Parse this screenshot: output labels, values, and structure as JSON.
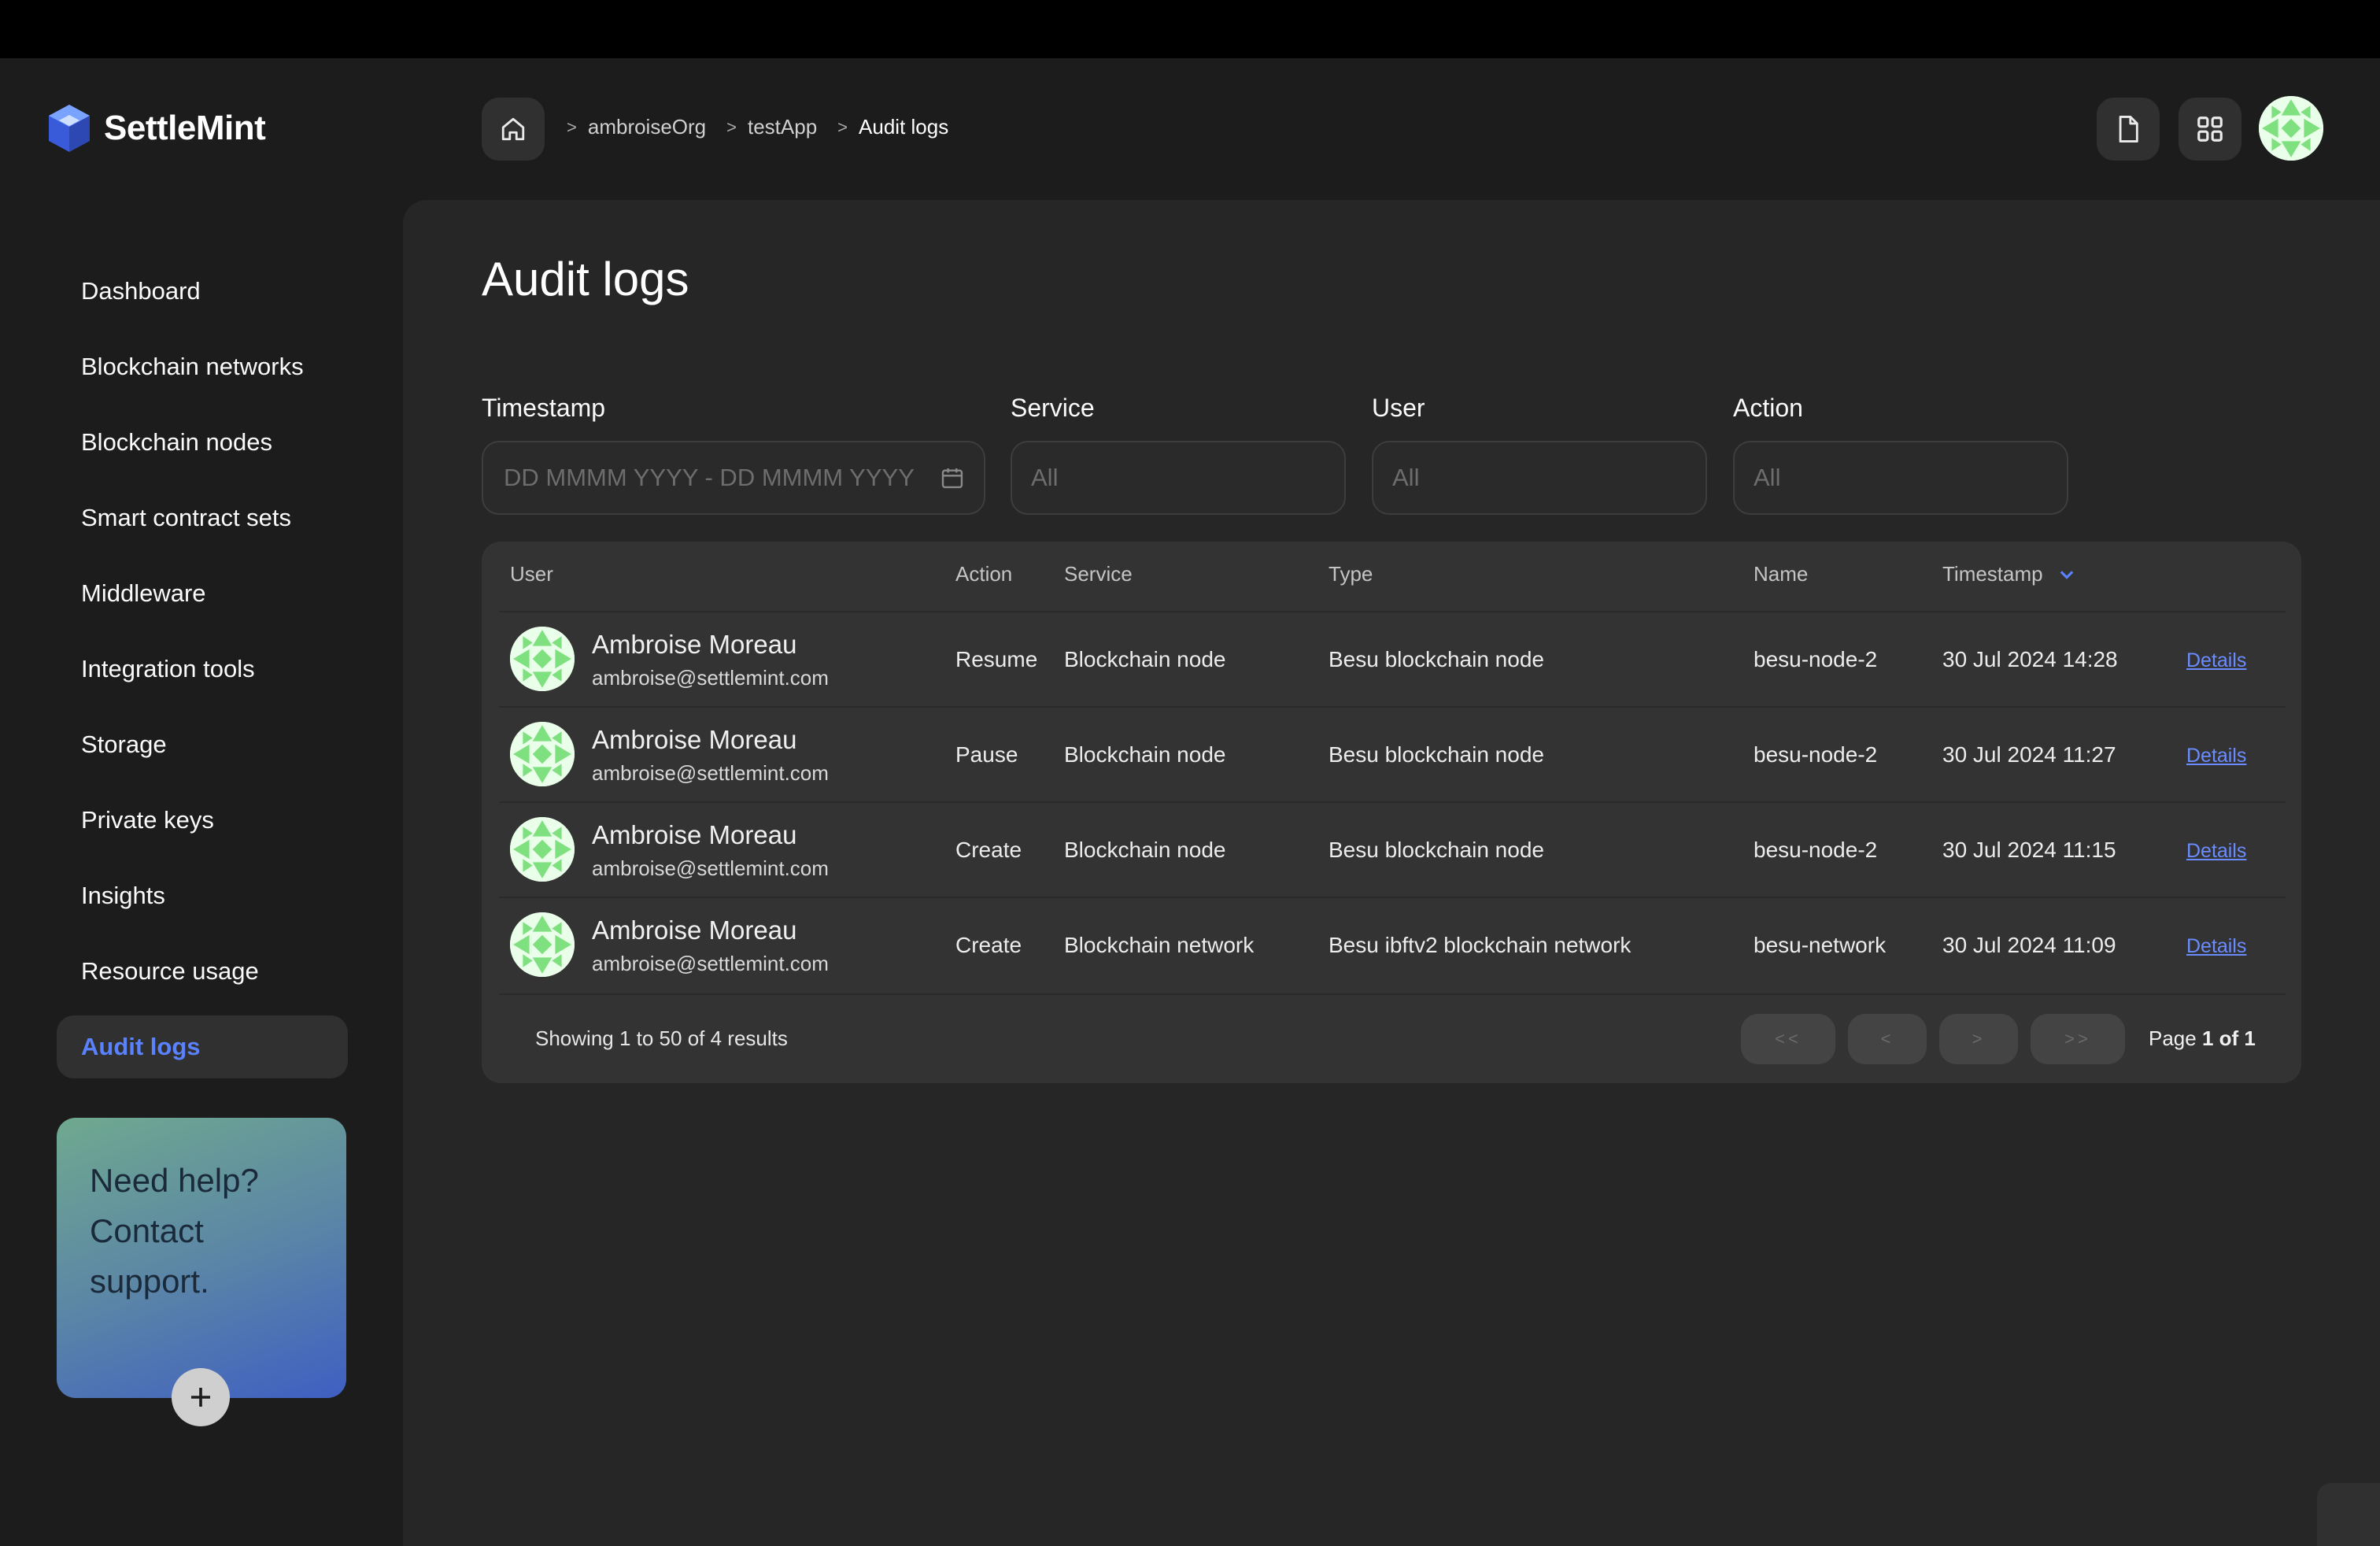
{
  "brand": {
    "name": "SettleMint"
  },
  "breadcrumb": [
    {
      "label": "ambroiseOrg"
    },
    {
      "label": "testApp"
    },
    {
      "label": "Audit logs"
    }
  ],
  "sidebar": {
    "items": [
      {
        "label": "Dashboard"
      },
      {
        "label": "Blockchain networks"
      },
      {
        "label": "Blockchain nodes"
      },
      {
        "label": "Smart contract sets"
      },
      {
        "label": "Middleware"
      },
      {
        "label": "Integration tools"
      },
      {
        "label": "Storage"
      },
      {
        "label": "Private keys"
      },
      {
        "label": "Insights"
      },
      {
        "label": "Resource usage"
      },
      {
        "label": "Audit logs",
        "active": true
      }
    ],
    "help": {
      "line1": "Need help?",
      "line2": "Contact",
      "line3": "support."
    }
  },
  "page": {
    "title": "Audit logs"
  },
  "filters": {
    "timestamp": {
      "label": "Timestamp",
      "placeholder": "DD MMMM YYYY - DD MMMM YYYY"
    },
    "service": {
      "label": "Service",
      "value": "All"
    },
    "user": {
      "label": "User",
      "value": "All"
    },
    "action": {
      "label": "Action",
      "value": "All"
    }
  },
  "table": {
    "headers": {
      "user": "User",
      "action": "Action",
      "service": "Service",
      "type": "Type",
      "name": "Name",
      "timestamp": "Timestamp"
    },
    "rows": [
      {
        "user_name": "Ambroise Moreau",
        "user_email": "ambroise@settlemint.com",
        "action": "Resume",
        "service": "Blockchain node",
        "type": "Besu blockchain node",
        "name": "besu-node-2",
        "timestamp": "30 Jul 2024 14:28",
        "details": "Details"
      },
      {
        "user_name": "Ambroise Moreau",
        "user_email": "ambroise@settlemint.com",
        "action": "Pause",
        "service": "Blockchain node",
        "type": "Besu blockchain node",
        "name": "besu-node-2",
        "timestamp": "30 Jul 2024 11:27",
        "details": "Details"
      },
      {
        "user_name": "Ambroise Moreau",
        "user_email": "ambroise@settlemint.com",
        "action": "Create",
        "service": "Blockchain node",
        "type": "Besu blockchain node",
        "name": "besu-node-2",
        "timestamp": "30 Jul 2024 11:15",
        "details": "Details"
      },
      {
        "user_name": "Ambroise Moreau",
        "user_email": "ambroise@settlemint.com",
        "action": "Create",
        "service": "Blockchain network",
        "type": "Besu ibftv2 blockchain network",
        "name": "besu-network",
        "timestamp": "30 Jul 2024 11:09",
        "details": "Details"
      }
    ],
    "footer": {
      "showing": "Showing 1 to 50 of 4 results",
      "first": "<<",
      "prev": "<",
      "next": ">",
      "last": ">>",
      "page_prefix": "Page",
      "page_current": "1 of 1"
    }
  },
  "icons": {
    "home": "home-icon",
    "document": "document-icon",
    "grid": "grid-icon",
    "calendar": "calendar-icon",
    "sort": "chevron-down-icon",
    "plus": "plus-icon",
    "logo": "cube-logo-icon"
  },
  "colors": {
    "accent": "#5a82ff",
    "link": "#6b8cff",
    "avatar": "#7fe07f"
  }
}
